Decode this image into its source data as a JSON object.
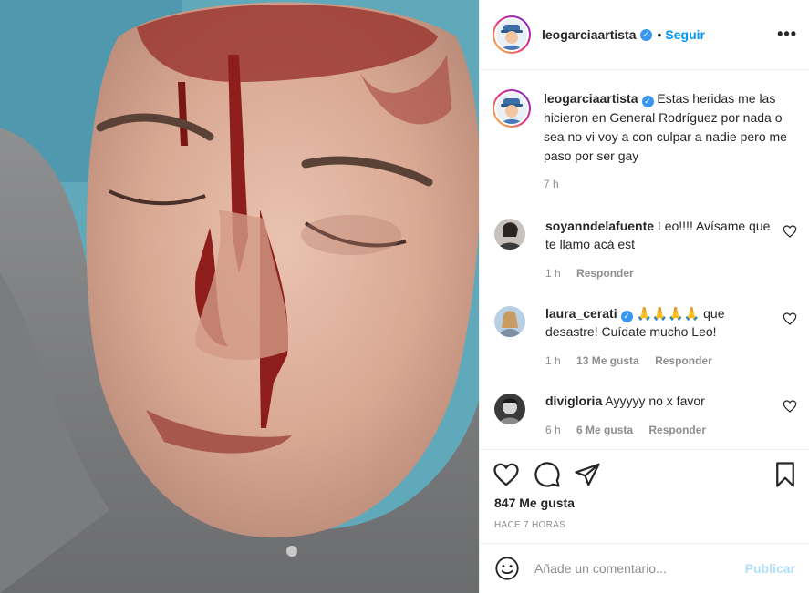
{
  "post": {
    "username": "leogarciaartista",
    "follow_label": "Seguir",
    "dot": "•",
    "more_label": "•••",
    "verified_mark": "✓"
  },
  "caption": {
    "username": "leogarciaartista",
    "text": "Estas heridas me las hicieron en General Rodríguez por nada o sea no vi voy a con culpar a nadie pero me paso por ser gay",
    "time": "7 h"
  },
  "comments": [
    {
      "username": "soyanndelafuente",
      "text": "Leo!!!! Avísame que te llamo acá est",
      "time": "1 h",
      "likes": "",
      "reply_label": "Responder"
    },
    {
      "username": "laura_cerati",
      "text": "🙏🙏🙏🙏 que desastre! Cuídate mucho Leo!",
      "time": "1 h",
      "likes": "13 Me gusta",
      "reply_label": "Responder"
    },
    {
      "username": "divigloria",
      "text": "Ayyyyy no x favor",
      "time": "6 h",
      "likes": "6 Me gusta",
      "reply_label": "Responder"
    }
  ],
  "actions": {
    "likes": "847 Me gusta",
    "time_ago": "HACE 7 HORAS"
  },
  "comment_box": {
    "placeholder": "Añade un comentario...",
    "publish_label": "Publicar"
  },
  "icons": [
    "heart-icon",
    "comment-icon",
    "share-icon",
    "bookmark-icon",
    "emoji-icon",
    "more-icon",
    "verified-icon"
  ],
  "colors": {
    "accent": "#0095f6",
    "publish_disabled": "#b2dffc",
    "secondary_text": "#8e8e8e",
    "verified": "#3897f0"
  }
}
